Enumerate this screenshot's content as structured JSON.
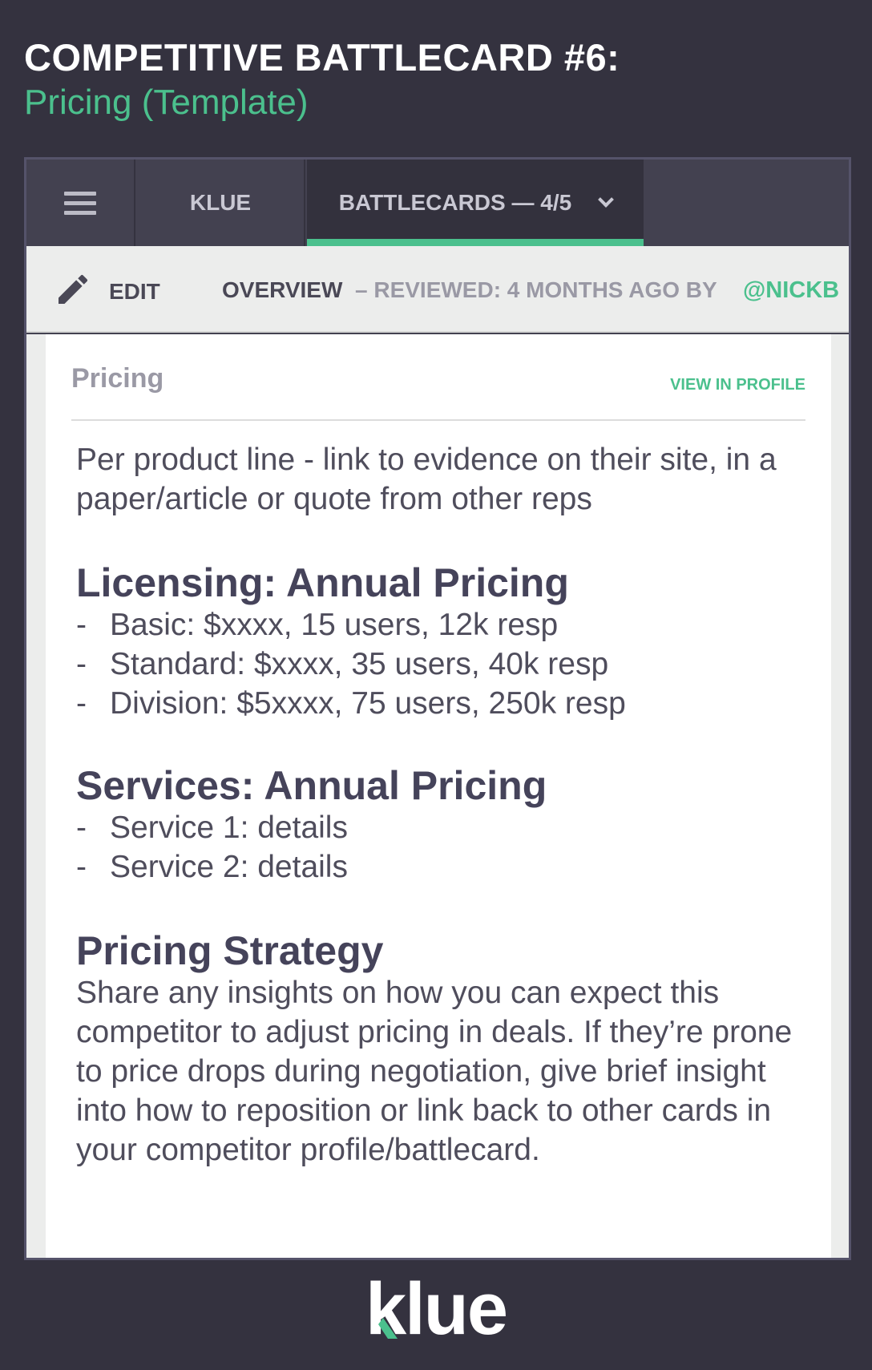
{
  "header": {
    "title": "COMPETITIVE BATTLECARD #6:",
    "subtitle": "Pricing (Template)"
  },
  "nav": {
    "menu_icon": "hamburger-menu-icon",
    "klue_label": "KLUE",
    "battlecards_label": "BATTLECARDS — 4/5",
    "dropdown_icon": "chevron-down-icon"
  },
  "toolbar": {
    "edit_icon": "pencil-icon",
    "edit_label": "EDIT",
    "overview_label": "OVERVIEW",
    "reviewed_text": "– REVIEWED: 4 MONTHS AGO BY",
    "user": "@NICKB"
  },
  "card": {
    "title": "Pricing",
    "view_link": "VIEW IN PROFILE",
    "intro": "Per product line - link to evidence on their site, in a paper/article or quote from other reps",
    "licensing": {
      "heading": "Licensing: Annual Pricing",
      "items": [
        "Basic: $xxxx, 15 users, 12k resp",
        "Standard: $xxxx, 35 users, 40k resp",
        "Division: $5xxxx, 75 users, 250k resp"
      ]
    },
    "services": {
      "heading": "Services: Annual Pricing",
      "items": [
        "Service 1: details",
        "Service 2: details"
      ]
    },
    "strategy": {
      "heading": "Pricing Strategy",
      "text": "Share any insights on how you can expect this competitor to adjust pricing in deals. If they’re prone to price drops during negotiation,  give brief insight into how to reposition or link back to other cards in your competitor profile/battlecard."
    }
  },
  "footer": {
    "logo_text": "klue"
  },
  "colors": {
    "background": "#34323f",
    "accent": "#4bc08d"
  }
}
